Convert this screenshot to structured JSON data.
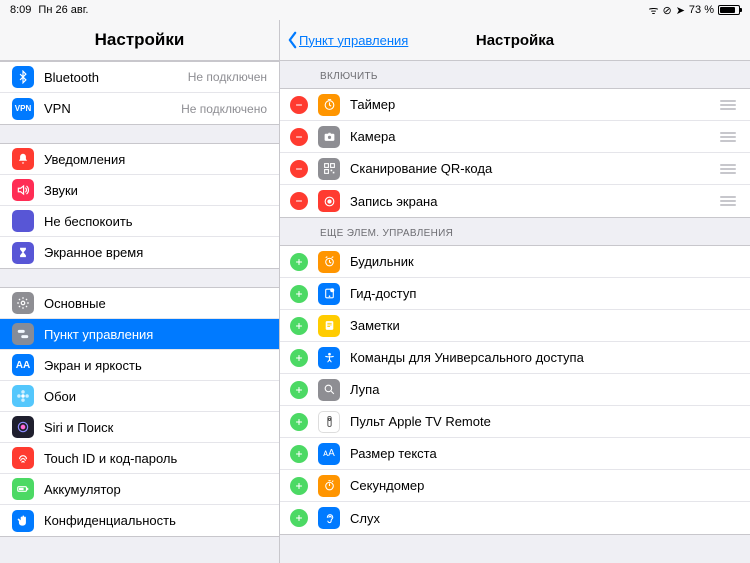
{
  "statusbar": {
    "time": "8:09",
    "date": "Пн 26 авг.",
    "battery": "73 %"
  },
  "sidebar": {
    "title": "Настройки",
    "group1": [
      {
        "label": "Bluetooth",
        "detail": "Не подключен",
        "bg": "#007aff",
        "icon": "bluetooth"
      },
      {
        "label": "VPN",
        "detail": "Не подключено",
        "bg": "#007aff",
        "icon": "vpn",
        "text": "VPN"
      }
    ],
    "group2": [
      {
        "label": "Уведомления",
        "bg": "#ff3b30",
        "icon": "bell"
      },
      {
        "label": "Звуки",
        "bg": "#ff2d55",
        "icon": "speaker"
      },
      {
        "label": "Не беспокоить",
        "bg": "#5856d6",
        "icon": "moon"
      },
      {
        "label": "Экранное время",
        "bg": "#5856d6",
        "icon": "hourglass"
      }
    ],
    "group3": [
      {
        "label": "Основные",
        "bg": "#8e8e93",
        "icon": "gear"
      },
      {
        "label": "Пункт управления",
        "bg": "#8e8e93",
        "icon": "switches",
        "selected": true
      },
      {
        "label": "Экран и яркость",
        "bg": "#007aff",
        "icon": "brightness",
        "text": "AA"
      },
      {
        "label": "Обои",
        "bg": "#54c7fc",
        "icon": "flower"
      },
      {
        "label": "Siri и Поиск",
        "bg": "#1f1f2e",
        "icon": "siri"
      },
      {
        "label": "Touch ID и код-пароль",
        "bg": "#ff3b30",
        "icon": "fingerprint"
      },
      {
        "label": "Аккумулятор",
        "bg": "#4cd964",
        "icon": "battery"
      },
      {
        "label": "Конфиденциальность",
        "bg": "#007aff",
        "icon": "hand"
      }
    ]
  },
  "detail": {
    "back": "Пункт управления",
    "title": "Настройка",
    "section1": "Включить",
    "include": [
      {
        "label": "Таймер",
        "bg": "#ff9500",
        "icon": "timer"
      },
      {
        "label": "Камера",
        "bg": "#8e8e93",
        "icon": "camera"
      },
      {
        "label": "Сканирование QR-кода",
        "bg": "#8e8e93",
        "icon": "qr"
      },
      {
        "label": "Запись экрана",
        "bg": "#ff3b30",
        "icon": "record"
      }
    ],
    "section2": "Еще элем. управления",
    "more": [
      {
        "label": "Будильник",
        "bg": "#ff9500",
        "icon": "alarm"
      },
      {
        "label": "Гид-доступ",
        "bg": "#007aff",
        "icon": "guide"
      },
      {
        "label": "Заметки",
        "bg": "#ffcc00",
        "icon": "note"
      },
      {
        "label": "Команды для Универсального доступа",
        "bg": "#007aff",
        "icon": "access"
      },
      {
        "label": "Лупа",
        "bg": "#8e8e93",
        "icon": "magnifier"
      },
      {
        "label": "Пульт Apple TV Remote",
        "bg": "#ffffff",
        "icon": "remote",
        "fg": "#333"
      },
      {
        "label": "Размер текста",
        "bg": "#007aff",
        "icon": "textsize",
        "text": "ᴀA"
      },
      {
        "label": "Секундомер",
        "bg": "#ff9500",
        "icon": "stopwatch"
      },
      {
        "label": "Слух",
        "bg": "#007aff",
        "icon": "ear"
      }
    ]
  }
}
